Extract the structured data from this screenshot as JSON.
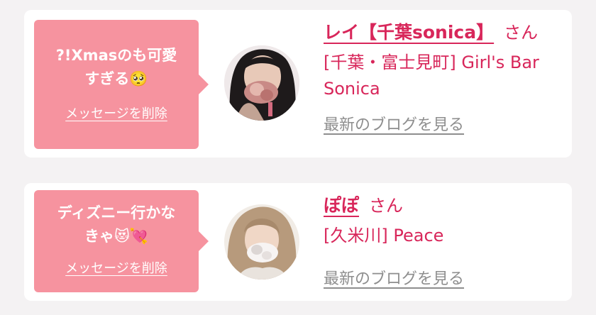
{
  "messages": [
    {
      "message": "?!Xmasのも可愛\nすぎる🥺",
      "delete_label": "メッセージを削除",
      "avatar_icon": "profile-photo",
      "name": "レイ【千葉sonica】",
      "honorific": "さん",
      "shop": "[千葉・富士見町] Girl's Bar Sonica",
      "blog_label": "最新のブログを見る"
    },
    {
      "message": "ディズニー行かな\nきゃ😻💘",
      "delete_label": "メッセージを削除",
      "avatar_icon": "profile-photo",
      "name": "ぽぽ",
      "honorific": "さん",
      "shop": "[久米川] Peace",
      "blog_label": "最新のブログを見る"
    }
  ],
  "colors": {
    "accent": "#d8265a",
    "bubble": "#f6939f",
    "link_gray": "#8e8e8e",
    "background": "#f4f2f3"
  }
}
